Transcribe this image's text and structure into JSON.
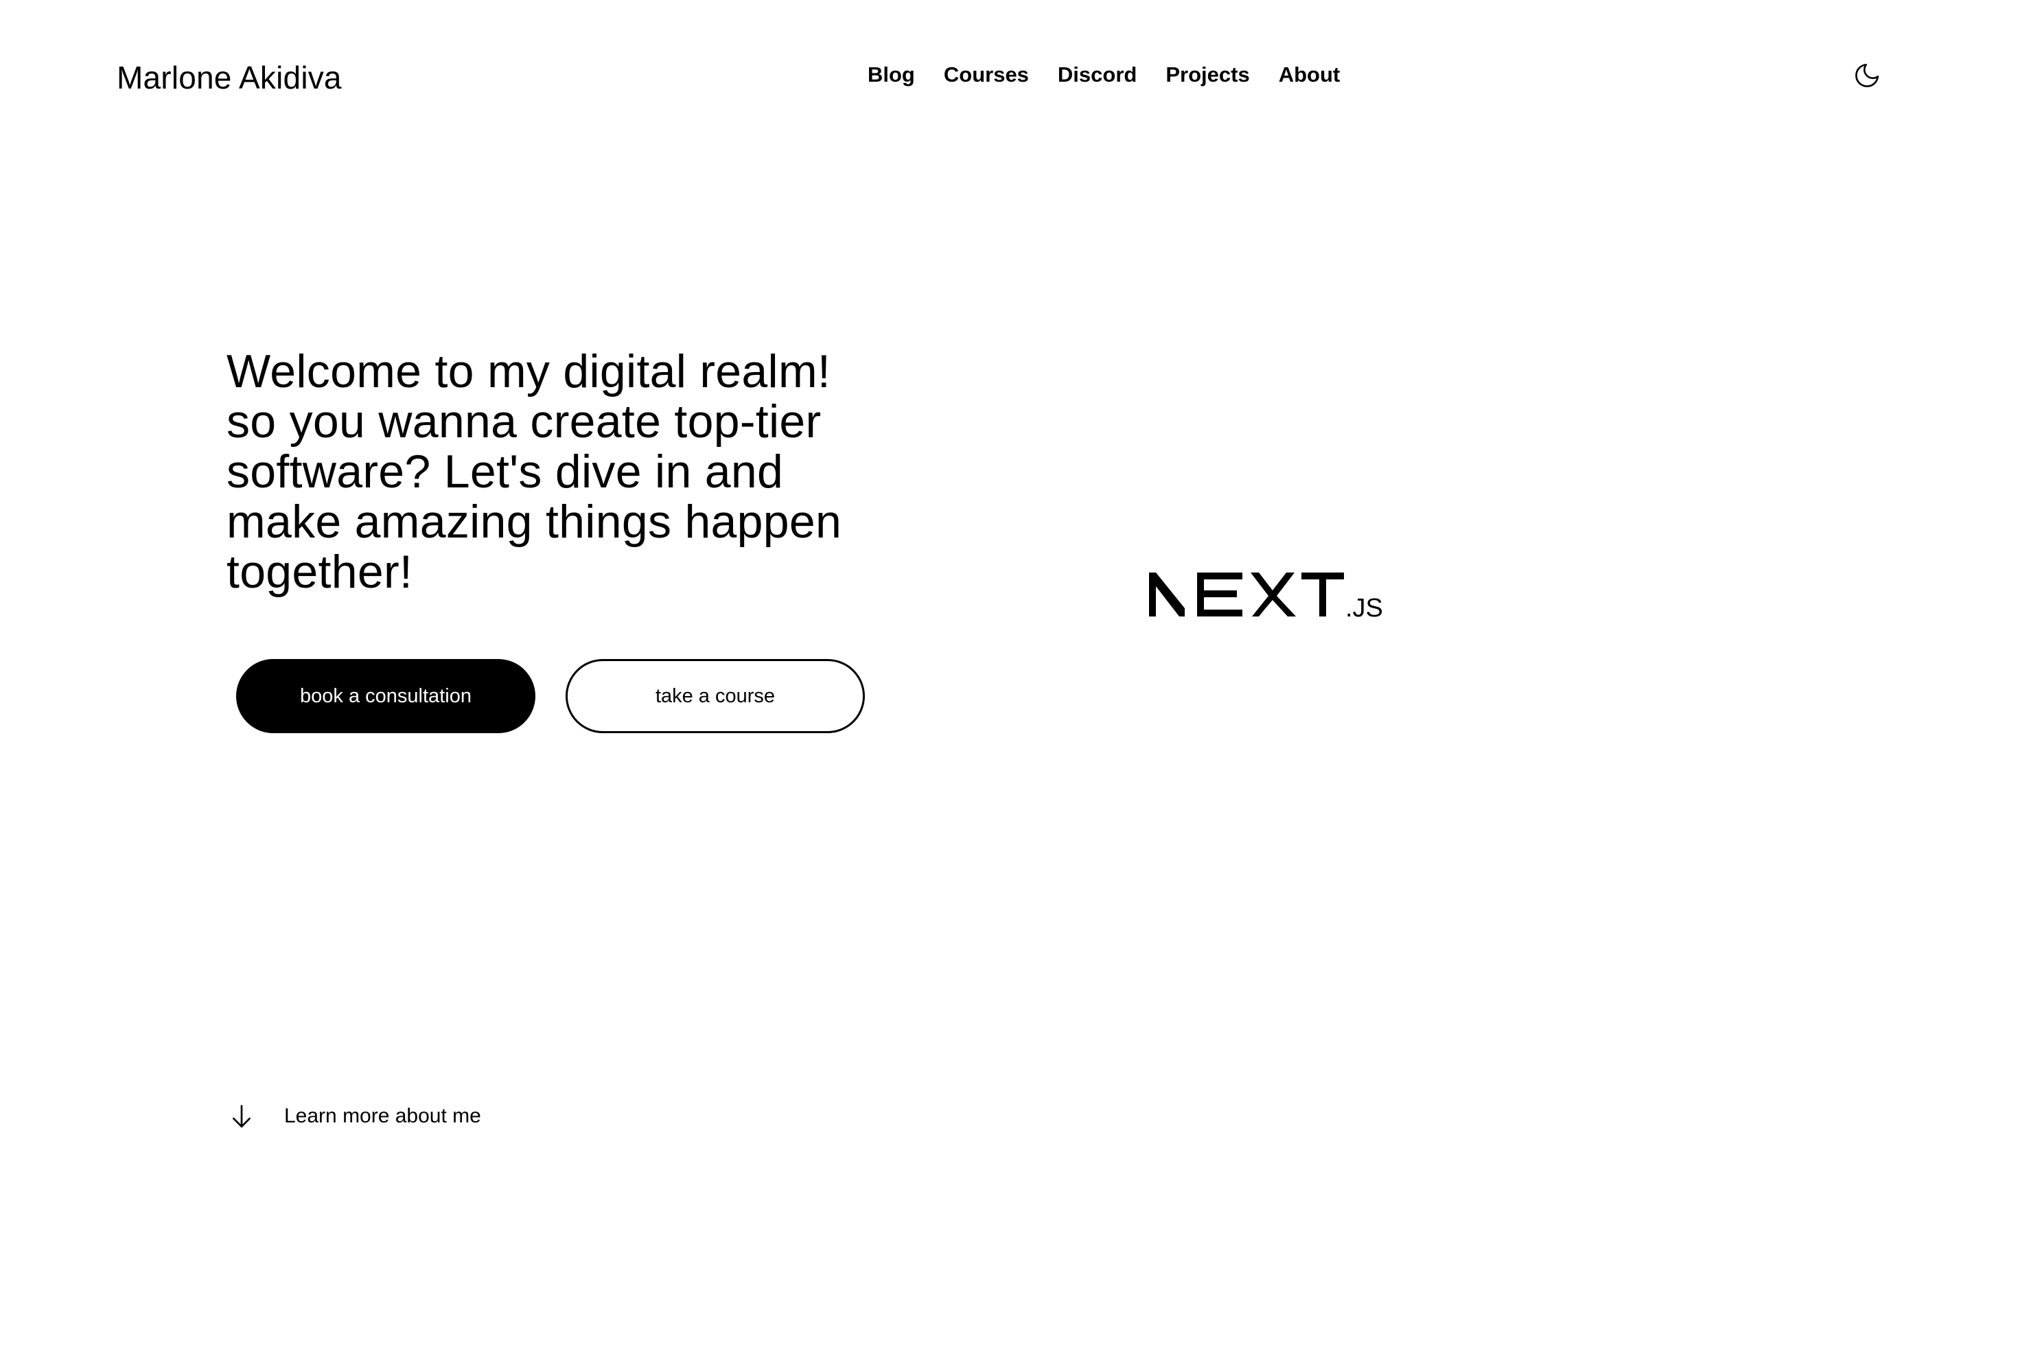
{
  "header": {
    "site_title": "Marlone Akidiva",
    "nav": [
      {
        "label": "Blog"
      },
      {
        "label": "Courses"
      },
      {
        "label": "Discord"
      },
      {
        "label": "Projects"
      },
      {
        "label": "About"
      }
    ],
    "theme_toggle_icon": "moon-icon"
  },
  "hero": {
    "text": "Welcome to my digital realm! so you wanna create top-tier software? Let's dive in and make amazing things happen together!",
    "primary_button": "book a consultation",
    "secondary_button": "take a course"
  },
  "logo": {
    "name": "nextjs-logo",
    "wordmark": "NEXT",
    "suffix": ".JS"
  },
  "learn_more": {
    "label": "Learn more about me",
    "icon": "arrow-down-icon"
  },
  "colors": {
    "background": "#ffffff",
    "text": "#000000",
    "primary_button_bg": "#000000",
    "primary_button_text": "#ffffff"
  }
}
